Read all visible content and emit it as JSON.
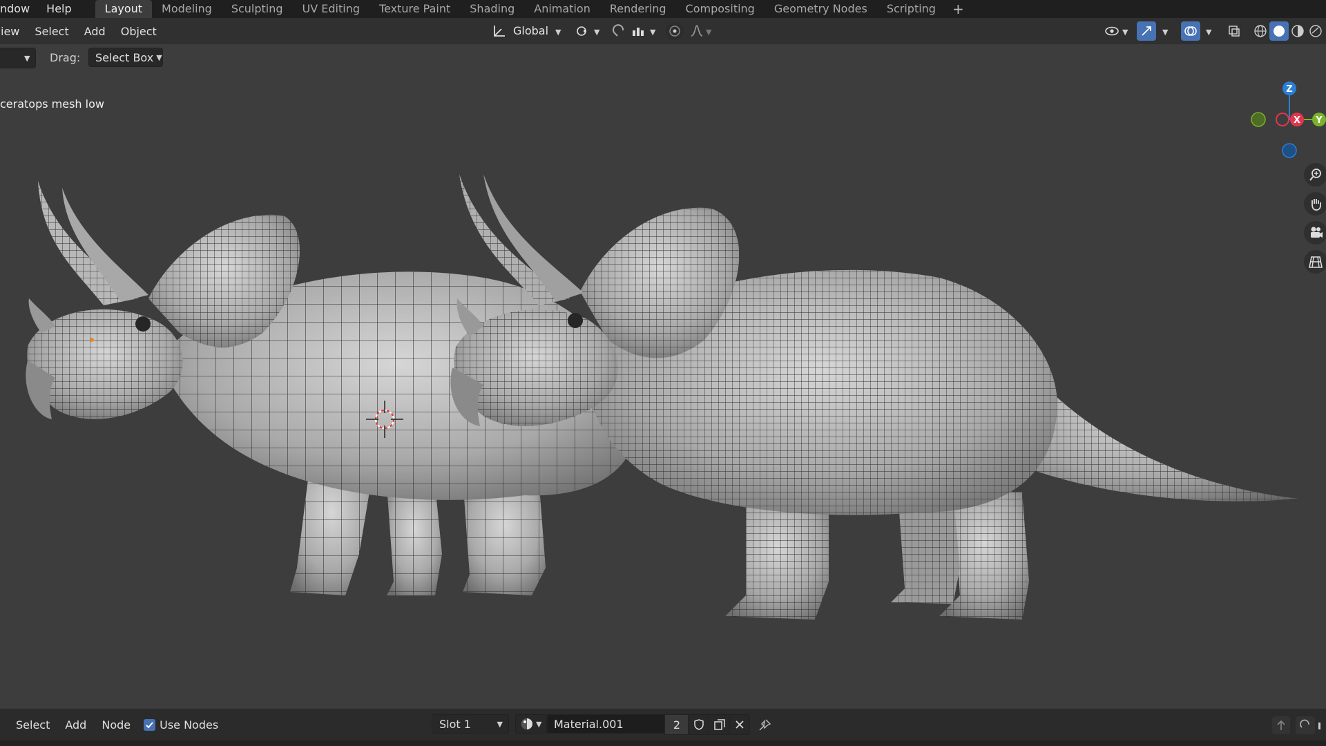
{
  "topbar": {
    "menus": [
      "ndow",
      "Help"
    ],
    "tabs": [
      "Layout",
      "Modeling",
      "Sculpting",
      "UV Editing",
      "Texture Paint",
      "Shading",
      "Animation",
      "Rendering",
      "Compositing",
      "Geometry Nodes",
      "Scripting"
    ],
    "active_tab": "Layout",
    "add_tab_symbol": "+"
  },
  "viewport_header": {
    "menus": [
      "iew",
      "Select",
      "Add",
      "Object"
    ],
    "transform_orientation": "Global"
  },
  "tool_settings": {
    "drag_label": "Drag:",
    "drag_value": "Select Box"
  },
  "viewport": {
    "object_label": "ceratops mesh low",
    "background_color": "#3d3d3d"
  },
  "gizmo": {
    "z_label": "Z",
    "x_label": "X",
    "y_label": "Y",
    "x_color": "#e0374e",
    "y_color": "#79b32a",
    "z_color": "#2b7fd6"
  },
  "nav_icons": [
    "zoom-icon",
    "hand-pan-icon",
    "camera-icon",
    "grid-ortho-icon"
  ],
  "bottom_header": {
    "menus": [
      "Select",
      "Add",
      "Node"
    ],
    "use_nodes_label": "Use Nodes",
    "slot": "Slot 1",
    "material_name": "Material.001",
    "user_count": "2"
  }
}
